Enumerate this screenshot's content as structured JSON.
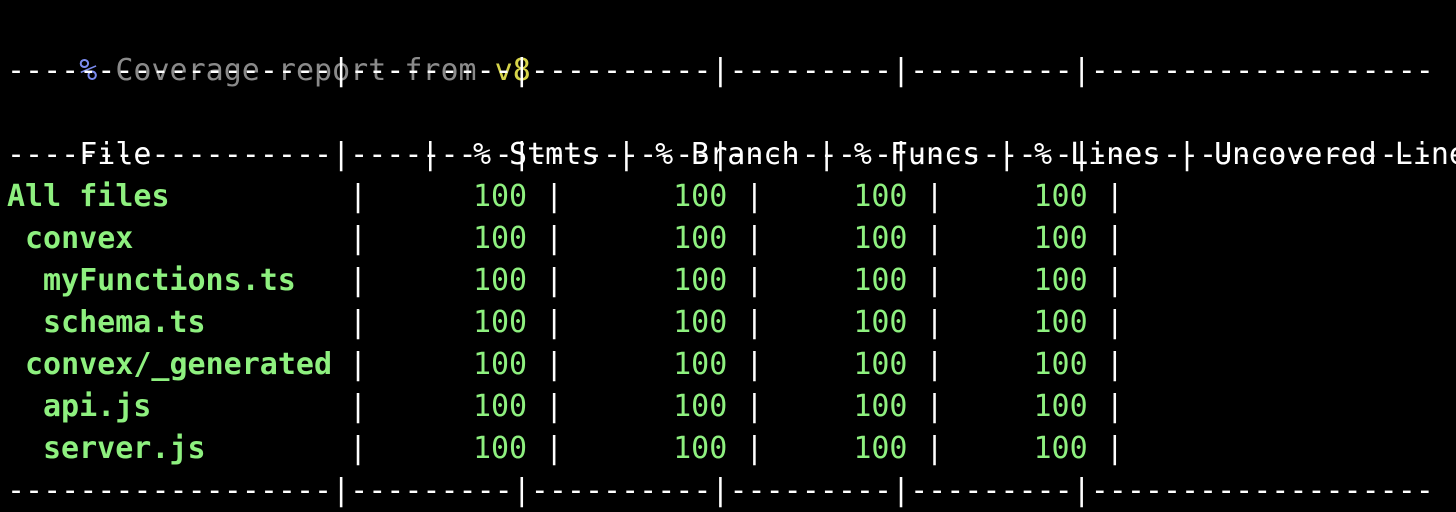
{
  "header": {
    "percent": "%",
    "text": "Coverage report from",
    "version": "v8"
  },
  "separator_line": "------------------|---------|----------|---------|---------|-------------------",
  "columns": {
    "file": "File",
    "stmts": "% Stmts",
    "branch": "% Branch",
    "funcs": "% Funcs",
    "lines": "% Lines",
    "uncovered": "Uncovered Line #s"
  },
  "rows": [
    {
      "file": "All files",
      "indent": 0,
      "stmts": "100",
      "branch": "100",
      "funcs": "100",
      "lines": "100",
      "uncovered": ""
    },
    {
      "file": "convex",
      "indent": 1,
      "stmts": "100",
      "branch": "100",
      "funcs": "100",
      "lines": "100",
      "uncovered": ""
    },
    {
      "file": "myFunctions.ts",
      "indent": 2,
      "stmts": "100",
      "branch": "100",
      "funcs": "100",
      "lines": "100",
      "uncovered": ""
    },
    {
      "file": "schema.ts",
      "indent": 2,
      "stmts": "100",
      "branch": "100",
      "funcs": "100",
      "lines": "100",
      "uncovered": ""
    },
    {
      "file": "convex/_generated",
      "indent": 1,
      "stmts": "100",
      "branch": "100",
      "funcs": "100",
      "lines": "100",
      "uncovered": ""
    },
    {
      "file": "api.js",
      "indent": 2,
      "stmts": "100",
      "branch": "100",
      "funcs": "100",
      "lines": "100",
      "uncovered": ""
    },
    {
      "file": "server.js",
      "indent": 2,
      "stmts": "100",
      "branch": "100",
      "funcs": "100",
      "lines": "100",
      "uncovered": ""
    }
  ],
  "colors": {
    "background": "#000000",
    "covered": "#8ef07f",
    "dim": "#8a8a8a",
    "percent_sign": "#7b8cf0",
    "version": "#d6d44a"
  }
}
